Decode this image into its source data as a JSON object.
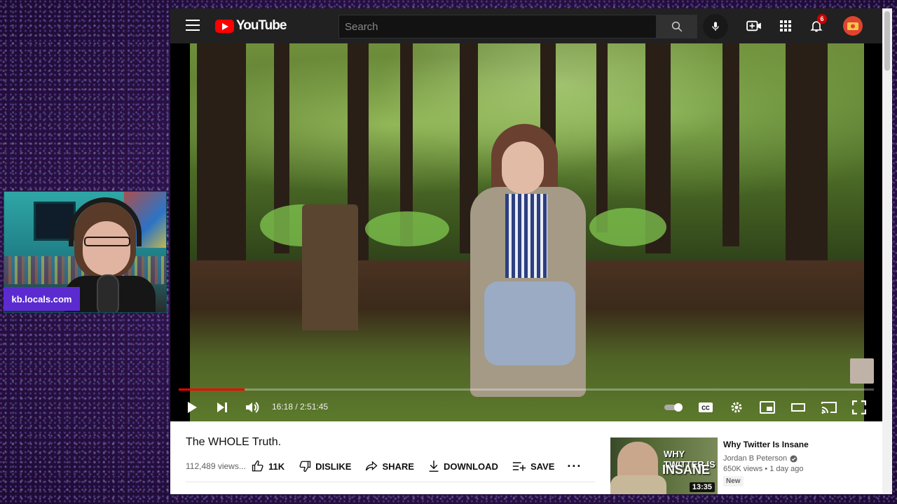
{
  "overlay": {
    "badge_text": "kb.locals.com"
  },
  "topbar": {
    "logo_text": "YouTube",
    "search_placeholder": "Search",
    "notification_count": "6"
  },
  "player": {
    "time_display": "16:18 / 2:51:45",
    "progress": 0.095,
    "accent_color": "#ff0000"
  },
  "video": {
    "title": "The WHOLE Truth.",
    "views": "112,489 views...",
    "actions": {
      "like": "11K",
      "dislike": "DISLIKE",
      "share": "SHARE",
      "download": "DOWNLOAD",
      "save": "SAVE"
    }
  },
  "recommendation": {
    "title": "Why Twitter Is Insane",
    "channel": "Jordan B Peterson",
    "stats": "650K views • 1 day ago",
    "badge": "New",
    "duration": "13:35",
    "thumb_line1": "WHY TWITTER IS",
    "thumb_line2": "INSANE"
  },
  "icons": {
    "menu": "hamburger-icon",
    "search": "search-icon",
    "mic": "mic-icon",
    "create": "create-video-icon",
    "apps": "apps-grid-icon",
    "bell": "bell-icon"
  }
}
